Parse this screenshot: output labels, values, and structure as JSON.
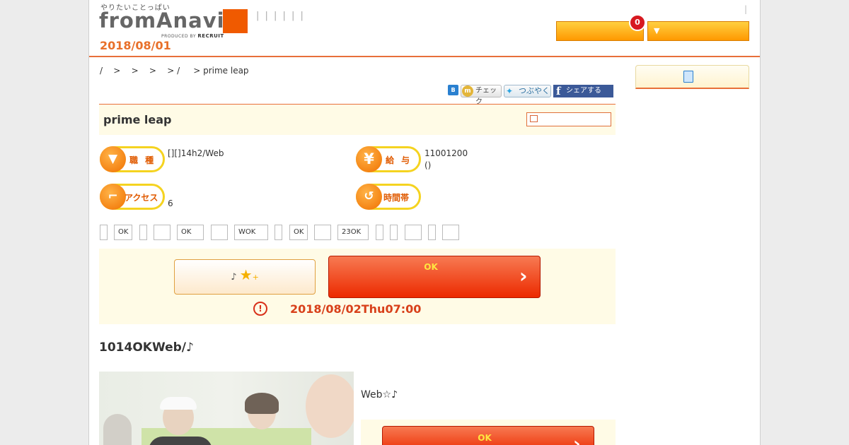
{
  "header": {
    "tagline": "やりたいことっぱい",
    "logo_text": "fromAnavi",
    "produced_by": "PRODUCED BY",
    "recruit": "RECRUIT",
    "nav_separators": "| | | | | |",
    "date": "2018/08/01",
    "top_separator": "|",
    "button1_label": "",
    "button2_label": "▼",
    "badge_count": "0"
  },
  "breadcrumb": "/    >    >    >    > /     > prime leap",
  "social": {
    "hatena": "B",
    "mixi": "チェック",
    "twitter": "つぶやく",
    "facebook": "シェアする"
  },
  "job": {
    "company": "prime leap",
    "occupation_label": "職 種",
    "occupation_value": "[][]14h2/Web",
    "salary_label": "給 与",
    "salary_line1": "11001200",
    "salary_line2": "()",
    "access_label": "アクセス",
    "access_value": "6",
    "hours_label": "時間帯",
    "hours_value": ""
  },
  "tags": [
    "",
    "OK",
    "",
    "",
    "OK",
    "",
    "WOK",
    "",
    "OK",
    "",
    "23OK",
    "",
    "",
    "",
    "",
    ""
  ],
  "apply": {
    "keep_label": "♪",
    "apply_label": "OK",
    "deadline": "2018/08/02Thu07:00"
  },
  "catchcopy": "1014OKWeb/♪",
  "description": "Web☆♪",
  "apply2_label": "OK",
  "colors": {
    "accent_orange": "#e8703a",
    "apply_red": "#ec2a00",
    "cream": "#fffbe6",
    "pill_yellow": "#f5d320"
  }
}
